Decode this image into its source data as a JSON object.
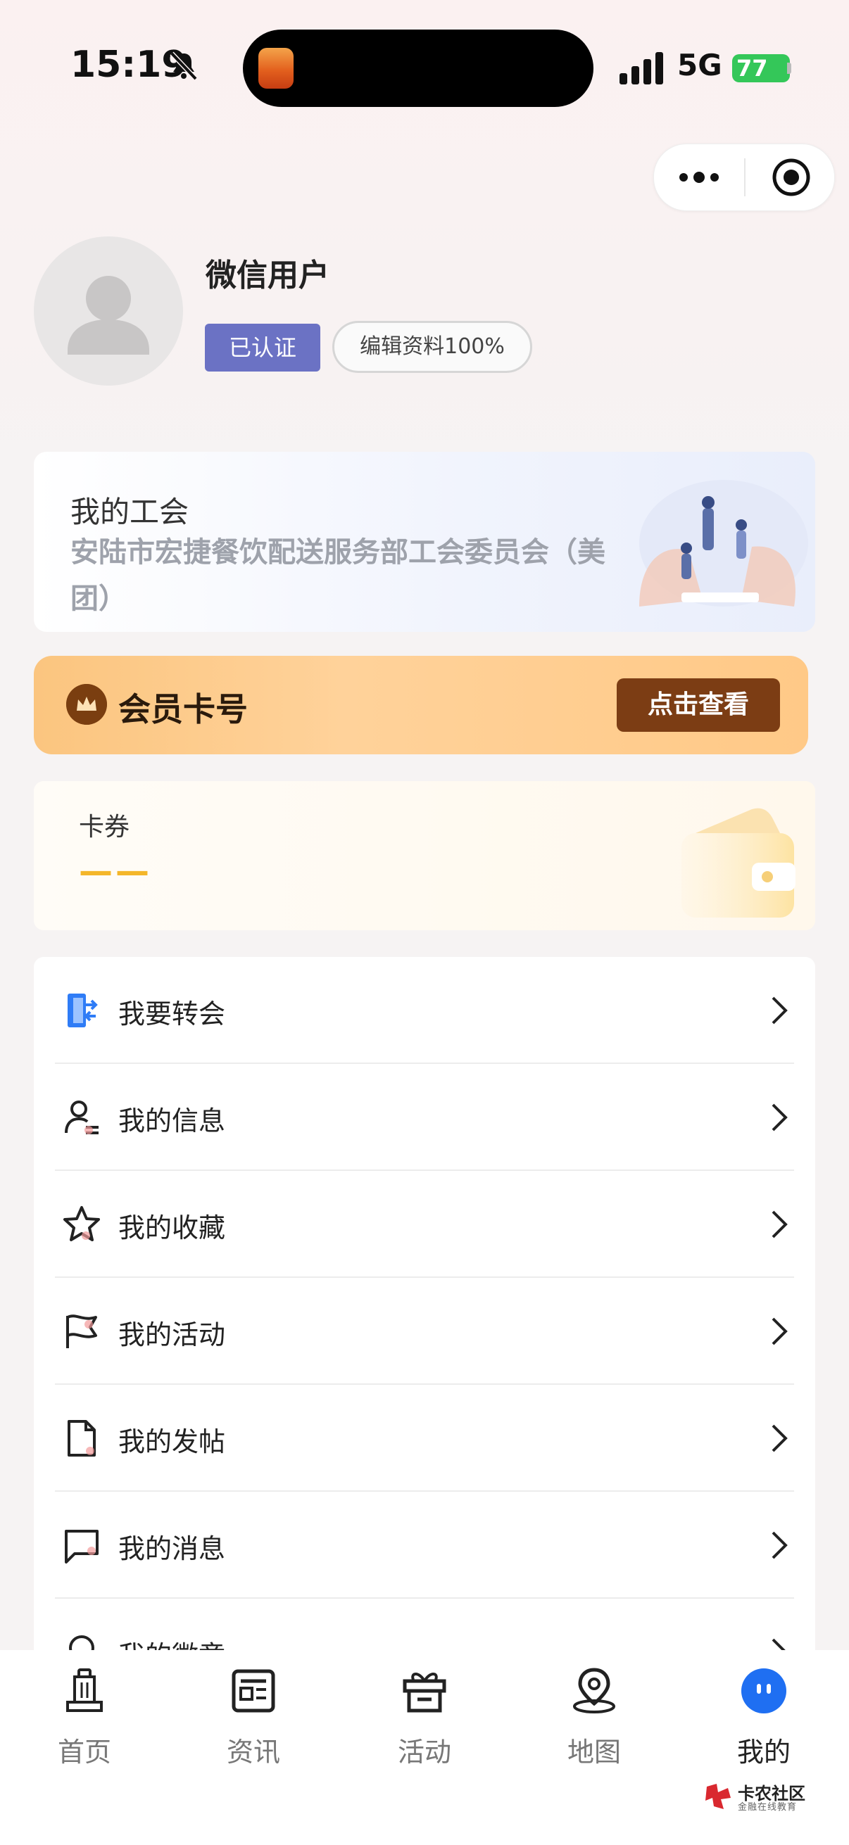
{
  "status_bar": {
    "time": "15:19",
    "network": "5G",
    "battery": "77"
  },
  "profile": {
    "username": "微信用户",
    "verified_badge": "已认证",
    "edit_profile": "编辑资料100%"
  },
  "union": {
    "title": "我的工会",
    "name": "安陆市宏捷餐饮配送服务部工会委员会（美团）"
  },
  "member_card": {
    "title": "会员卡号",
    "button": "点击查看"
  },
  "coupon": {
    "title": "卡券",
    "value": "——"
  },
  "menu": {
    "items": [
      {
        "label": "我要转会",
        "icon": "transfer-door-icon"
      },
      {
        "label": "我的信息",
        "icon": "user-info-icon"
      },
      {
        "label": "我的收藏",
        "icon": "star-icon"
      },
      {
        "label": "我的活动",
        "icon": "flag-icon"
      },
      {
        "label": "我的发帖",
        "icon": "document-icon"
      },
      {
        "label": "我的消息",
        "icon": "message-icon"
      },
      {
        "label": "我的徽章",
        "icon": "badge-icon"
      }
    ]
  },
  "tabbar": {
    "items": [
      {
        "label": "首页",
        "icon": "monument-icon"
      },
      {
        "label": "资讯",
        "icon": "news-icon"
      },
      {
        "label": "活动",
        "icon": "gift-icon"
      },
      {
        "label": "地图",
        "icon": "map-pin-icon"
      },
      {
        "label": "我的",
        "icon": "profile-face-icon",
        "active": true
      }
    ]
  },
  "watermark": {
    "title": "卡农社区",
    "subtitle": "金融在线教育"
  },
  "colors": {
    "verified_badge": "#6b72c4",
    "member_button": "#7c3d14",
    "coupon_value": "#f4b62a",
    "active_tab": "#1f6ff2"
  }
}
